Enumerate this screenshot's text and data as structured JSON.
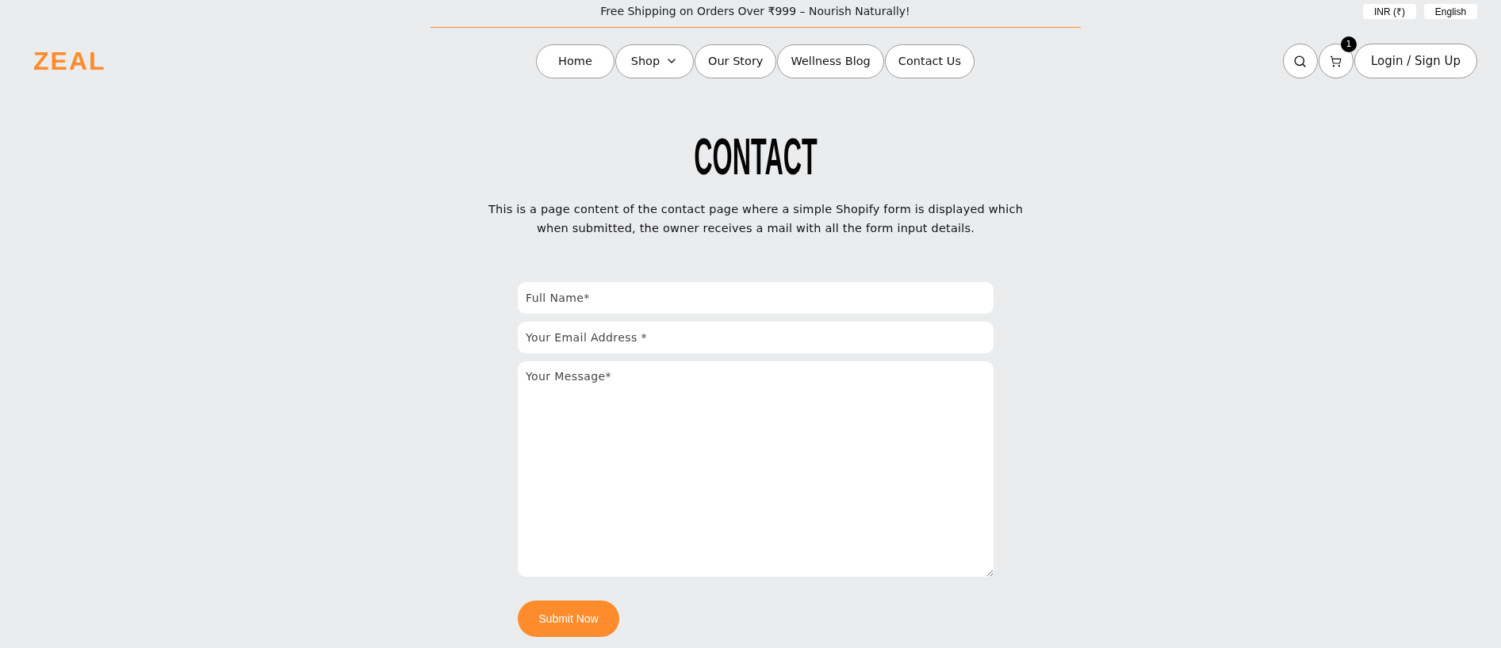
{
  "announcement_bar": {
    "text": "Free Shipping on Orders Over ₹999 – Nourish Naturally!"
  },
  "locale": {
    "currency": "INR (₹)",
    "language": "English"
  },
  "header": {
    "logo": "ZEAL",
    "nav": [
      {
        "label": "Home",
        "kind": "link"
      },
      {
        "label": "Shop",
        "kind": "dropdown"
      },
      {
        "label": "Our Story",
        "kind": "link"
      },
      {
        "label": "Wellness Blog",
        "kind": "link"
      },
      {
        "label": "Contact Us",
        "kind": "link"
      }
    ],
    "cart_count": "1",
    "login": "Login / Sign Up"
  },
  "page": {
    "title": "CONTACT",
    "intro": "This is a page content of the contact page where a simple Shopify form is displayed which when submitted, the owner receives a mail with all the form input details."
  },
  "form": {
    "fields": [
      {
        "kind": "input",
        "placeholder": "Full Name*"
      },
      {
        "kind": "input",
        "placeholder": "Your Email Address *"
      },
      {
        "kind": "textarea",
        "placeholder": "Your Message*"
      }
    ],
    "submit": "Submit Now"
  }
}
